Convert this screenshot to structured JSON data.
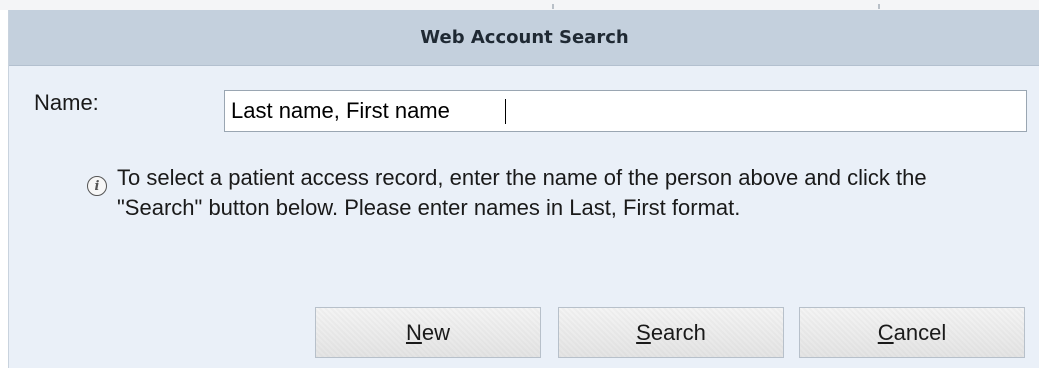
{
  "dialog": {
    "title": "Web Account Search",
    "name_label": "Name:",
    "name_value": "Last name, First name",
    "info_text": "To select a patient access record, enter the name of the person above and click the \"Search\" button below. Please enter names in Last, First format."
  },
  "buttons": {
    "new": {
      "accel": "N",
      "rest": "ew"
    },
    "search": {
      "accel": "S",
      "rest": "earch"
    },
    "cancel": {
      "accel": "C",
      "rest": "ancel"
    }
  },
  "colors": {
    "titlebar": "#c4d0dd",
    "dialog_bg": "#eaf0f8"
  },
  "icons": {
    "info": "info-icon"
  }
}
